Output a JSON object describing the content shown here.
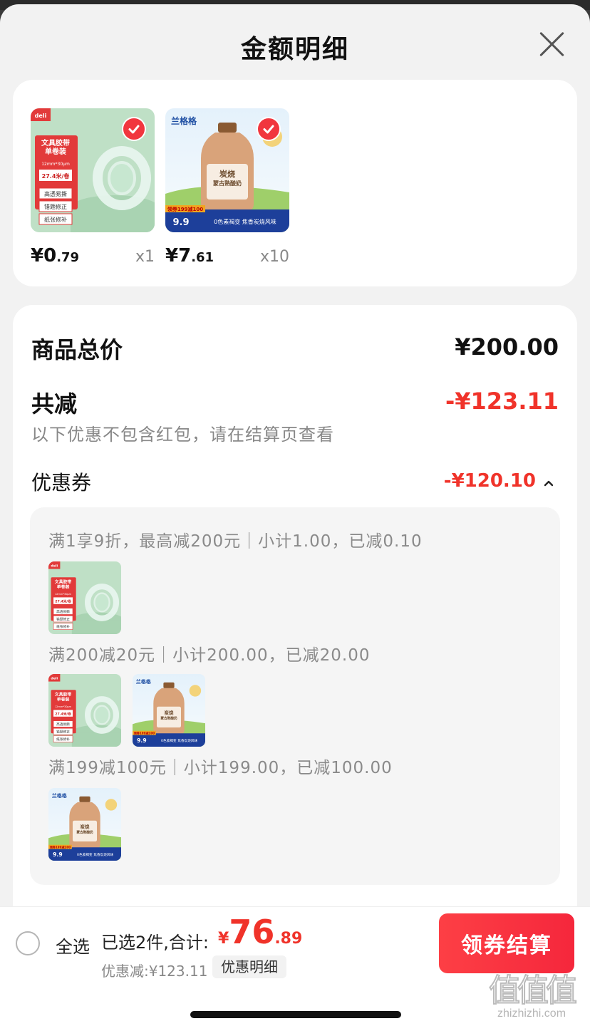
{
  "header": {
    "title": "金额明细"
  },
  "products": [
    {
      "price_int": "¥0",
      "price_dec": ".79",
      "qty": "x1",
      "selected": true,
      "kind": "tape"
    },
    {
      "price_int": "¥7",
      "price_dec": ".61",
      "qty": "x10",
      "selected": true,
      "kind": "yogurt"
    }
  ],
  "tape_art": {
    "brand": "deli",
    "title": "文具胶带\n单卷装",
    "spec": "12mm*30μm",
    "length": "27.4米/卷",
    "features": [
      "高透易撕",
      "错题修正",
      "纸张修补"
    ]
  },
  "yogurt_art": {
    "brand": "兰格格",
    "label": "炭烧\n蒙古熟酸奶",
    "promo": "领券199减100",
    "price": "9.9",
    "slogan": "0色素褐变 焦香炭烧风味"
  },
  "summary": {
    "total_label": "商品总价",
    "total_value": "¥200.00",
    "reduce_label": "共减",
    "reduce_value": "-¥123.11",
    "note": "以下优惠不包含红包，请在结算页查看",
    "coupon_label": "优惠券",
    "coupon_value": "-¥120.10"
  },
  "coupon_rules": [
    {
      "text": "满1享9折，最高减200元｜小计1.00，已减0.10",
      "thumbs": [
        "tape"
      ]
    },
    {
      "text": "满200减20元｜小计200.00，已减20.00",
      "thumbs": [
        "tape",
        "yogurt"
      ]
    },
    {
      "text": "满199减100元｜小计199.00，已减100.00",
      "thumbs": [
        "yogurt"
      ]
    }
  ],
  "footer": {
    "select_all": "全选",
    "selected_text": "已选2件,合计:",
    "total_symbol": "¥",
    "total_int": "76",
    "total_dec": ".89",
    "discount_text": "优惠减:¥123.11",
    "detail_chip": "优惠明细",
    "checkout": "领券结算"
  },
  "watermark": {
    "glyphs": "值值值",
    "url": "zhizhizhi.com"
  },
  "colors": {
    "accent": "#f0332a",
    "button": "#f52a3c",
    "background": "#f2f2f2",
    "card": "#ffffff"
  }
}
